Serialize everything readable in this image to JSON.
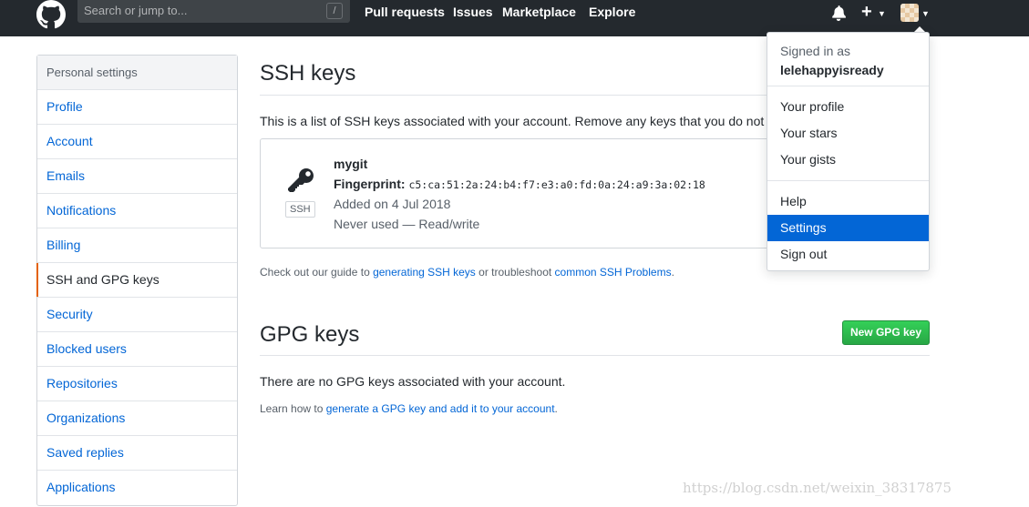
{
  "header": {
    "search_placeholder": "Search or jump to...",
    "slash_key": "/",
    "nav": [
      "Pull requests",
      "Issues",
      "Marketplace",
      "Explore"
    ],
    "plus_label": "+"
  },
  "sidebar": {
    "heading": "Personal settings",
    "items": [
      {
        "label": "Profile"
      },
      {
        "label": "Account"
      },
      {
        "label": "Emails"
      },
      {
        "label": "Notifications"
      },
      {
        "label": "Billing"
      },
      {
        "label": "SSH and GPG keys",
        "active": true
      },
      {
        "label": "Security"
      },
      {
        "label": "Blocked users"
      },
      {
        "label": "Repositories"
      },
      {
        "label": "Organizations"
      },
      {
        "label": "Saved replies"
      },
      {
        "label": "Applications"
      }
    ]
  },
  "ssh": {
    "title": "SSH keys",
    "description": "This is a list of SSH keys associated with your account. Remove any keys that you do not re",
    "key": {
      "badge": "SSH",
      "name": "mygit",
      "fingerprint_label": "Fingerprint:",
      "fingerprint": "c5:ca:51:2a:24:b4:f7:e3:a0:fd:0a:24:a9:3a:02:18",
      "added": "Added on 4 Jul 2018",
      "usage": "Never used — Read/write"
    },
    "guide": {
      "prefix": "Check out our guide to ",
      "link1": "generating SSH keys",
      "middle": " or troubleshoot ",
      "link2": "common SSH Problems",
      "suffix": "."
    }
  },
  "gpg": {
    "title": "GPG keys",
    "new_button": "New GPG key",
    "empty": "There are no GPG keys associated with your account.",
    "learn": {
      "prefix": "Learn how to ",
      "link": "generate a GPG key and add it to your account",
      "suffix": "."
    }
  },
  "dropdown": {
    "signed_in_as": "Signed in as",
    "username": "lelehappyisready",
    "group1": [
      "Your profile",
      "Your stars",
      "Your gists"
    ],
    "group2": [
      "Help",
      "Settings",
      "Sign out"
    ],
    "selected": "Settings"
  },
  "watermark": "https://blog.csdn.net/weixin_38317875",
  "colors": {
    "header_bg": "#24292e",
    "link": "#0366d6",
    "selected_bg": "#0366d6",
    "button_green": "#28a745",
    "active_marker": "#e36209"
  }
}
